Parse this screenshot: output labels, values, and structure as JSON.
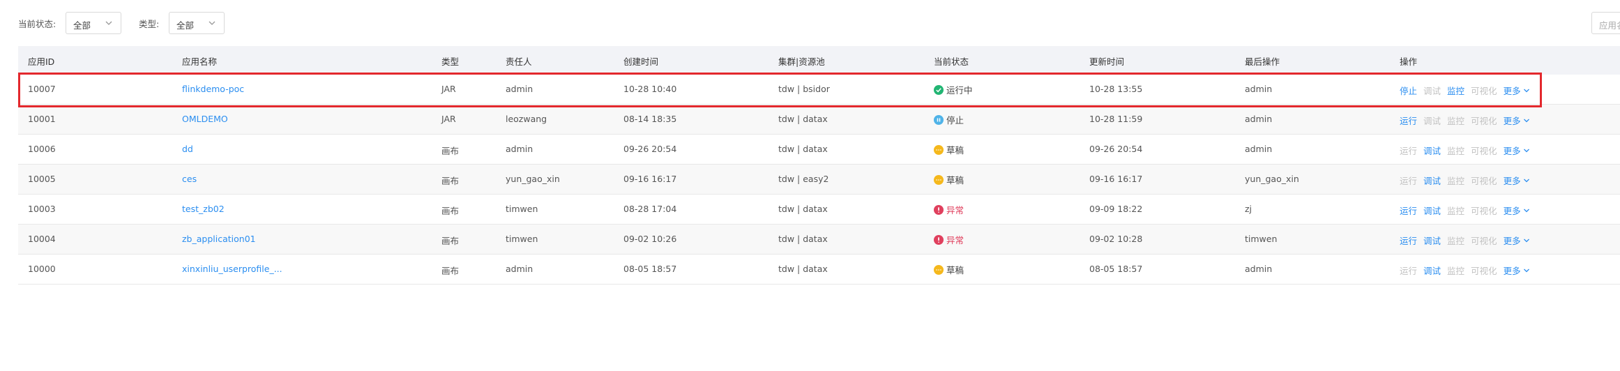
{
  "filters": {
    "status_label": "当前状态:",
    "status_value": "全部",
    "type_label": "类型:",
    "type_value": "全部",
    "apply_label": "应用名"
  },
  "columns": [
    "应用ID",
    "应用名称",
    "类型",
    "责任人",
    "创建时间",
    "集群|资源池",
    "当前状态",
    "更新时间",
    "最后操作",
    "操作"
  ],
  "rows": [
    {
      "id": "10007",
      "name": "flinkdemo-poc",
      "type": "JAR",
      "owner": "admin",
      "created": "10-28 10:40",
      "cluster": "tdw | bsidor",
      "status": "运行中",
      "status_kind": "running",
      "updated": "10-28 13:55",
      "last_op": "admin",
      "ops": [
        {
          "label": "停止",
          "on": true
        },
        {
          "label": "调试",
          "on": false
        },
        {
          "label": "监控",
          "on": true
        },
        {
          "label": "可视化",
          "on": false
        }
      ]
    },
    {
      "id": "10001",
      "name": "OMLDEMO",
      "type": "JAR",
      "owner": "leozwang",
      "created": "08-14 18:35",
      "cluster": "tdw | datax",
      "status": "停止",
      "status_kind": "stopped",
      "updated": "10-28 11:59",
      "last_op": "admin",
      "ops": [
        {
          "label": "运行",
          "on": true
        },
        {
          "label": "调试",
          "on": false
        },
        {
          "label": "监控",
          "on": false
        },
        {
          "label": "可视化",
          "on": false
        }
      ]
    },
    {
      "id": "10006",
      "name": "dd",
      "type": "画布",
      "owner": "admin",
      "created": "09-26 20:54",
      "cluster": "tdw | datax",
      "status": "草稿",
      "status_kind": "draft",
      "updated": "09-26 20:54",
      "last_op": "admin",
      "ops": [
        {
          "label": "运行",
          "on": false
        },
        {
          "label": "调试",
          "on": true
        },
        {
          "label": "监控",
          "on": false
        },
        {
          "label": "可视化",
          "on": false
        }
      ]
    },
    {
      "id": "10005",
      "name": "ces",
      "type": "画布",
      "owner": "yun_gao_xin",
      "created": "09-16 16:17",
      "cluster": "tdw | easy2",
      "status": "草稿",
      "status_kind": "draft",
      "updated": "09-16 16:17",
      "last_op": "yun_gao_xin",
      "ops": [
        {
          "label": "运行",
          "on": false
        },
        {
          "label": "调试",
          "on": true
        },
        {
          "label": "监控",
          "on": false
        },
        {
          "label": "可视化",
          "on": false
        }
      ]
    },
    {
      "id": "10003",
      "name": "test_zb02",
      "type": "画布",
      "owner": "timwen",
      "created": "08-28 17:04",
      "cluster": "tdw | datax",
      "status": "异常",
      "status_kind": "error",
      "updated": "09-09 18:22",
      "last_op": "zj",
      "ops": [
        {
          "label": "运行",
          "on": true
        },
        {
          "label": "调试",
          "on": true
        },
        {
          "label": "监控",
          "on": false
        },
        {
          "label": "可视化",
          "on": false
        }
      ]
    },
    {
      "id": "10004",
      "name": "zb_application01",
      "type": "画布",
      "owner": "timwen",
      "created": "09-02 10:26",
      "cluster": "tdw | datax",
      "status": "异常",
      "status_kind": "error",
      "updated": "09-02 10:28",
      "last_op": "timwen",
      "ops": [
        {
          "label": "运行",
          "on": true
        },
        {
          "label": "调试",
          "on": true
        },
        {
          "label": "监控",
          "on": false
        },
        {
          "label": "可视化",
          "on": false
        }
      ]
    },
    {
      "id": "10000",
      "name": "xinxinliu_userprofile_...",
      "type": "画布",
      "owner": "admin",
      "created": "08-05 18:57",
      "cluster": "tdw | datax",
      "status": "草稿",
      "status_kind": "draft",
      "updated": "08-05 18:57",
      "last_op": "admin",
      "ops": [
        {
          "label": "运行",
          "on": false
        },
        {
          "label": "调试",
          "on": true
        },
        {
          "label": "监控",
          "on": false
        },
        {
          "label": "可视化",
          "on": false
        }
      ]
    }
  ],
  "more_label": "更多",
  "colors": {
    "link": "#2b8ef0",
    "running": "#22b573",
    "stopped": "#4fb3e8",
    "draft": "#f5b81c",
    "error": "#e0405e",
    "highlight": "#e3282d"
  }
}
